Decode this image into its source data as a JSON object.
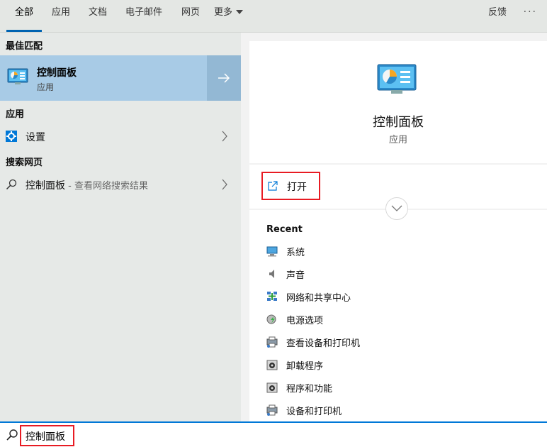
{
  "tabs": [
    {
      "label": "全部",
      "active": true
    },
    {
      "label": "应用"
    },
    {
      "label": "文档"
    },
    {
      "label": "电子邮件"
    },
    {
      "label": "网页"
    },
    {
      "label": "更多"
    }
  ],
  "header": {
    "feedback_label": "反馈",
    "more_options": "···"
  },
  "left": {
    "best_match_heading": "最佳匹配",
    "best_match": {
      "title": "控制面板",
      "subtitle": "应用",
      "icon": "control-panel-icon"
    },
    "apps_heading": "应用",
    "apps": [
      {
        "label": "设置",
        "icon": "settings-gear-icon"
      }
    ],
    "web_heading": "搜索网页",
    "web": [
      {
        "label": "控制面板",
        "hint": " - 查看网络搜索结果",
        "icon": "search-icon"
      }
    ]
  },
  "right": {
    "app_title": "控制面板",
    "app_subtitle": "应用",
    "open_label": "打开",
    "recent_heading": "Recent",
    "recent": [
      {
        "label": "系统",
        "icon": "system-monitor-icon"
      },
      {
        "label": "声音",
        "icon": "speaker-icon"
      },
      {
        "label": "网络和共享中心",
        "icon": "network-icon"
      },
      {
        "label": "电源选项",
        "icon": "power-options-icon"
      },
      {
        "label": "查看设备和打印机",
        "icon": "printer-icon"
      },
      {
        "label": "卸载程序",
        "icon": "programs-icon"
      },
      {
        "label": "程序和功能",
        "icon": "programs-icon"
      },
      {
        "label": "设备和打印机",
        "icon": "printer-icon"
      }
    ]
  },
  "search": {
    "query": "控制面板"
  },
  "colors": {
    "accent": "#0063b1",
    "highlight": "#a8cbe6",
    "annotation_red": "#e81b23"
  }
}
